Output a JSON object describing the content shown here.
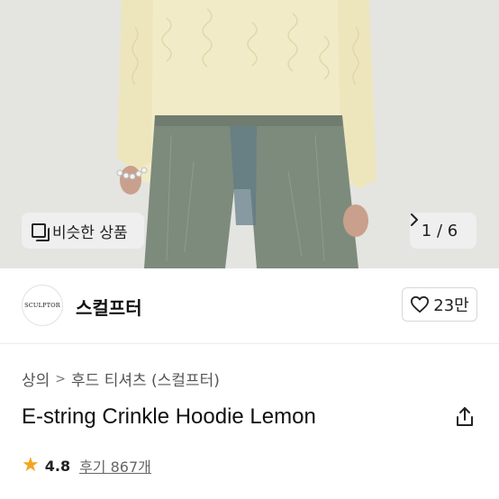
{
  "product_image": {
    "similar_button_label": "비슷한 상품",
    "pager": {
      "current": "1",
      "separator": "/",
      "total": "6",
      "text": "1 / 6"
    }
  },
  "brand": {
    "logo_text": "SCULPTOR",
    "name": "스컬프터",
    "like_count": "23만"
  },
  "breadcrumb": {
    "items": [
      "상의",
      "후드 티셔츠 (스컬프터)"
    ],
    "separator": ">"
  },
  "product": {
    "title": "E-string Crinkle Hoodie Lemon"
  },
  "rating": {
    "score": "4.8",
    "reviews_label": "후기 867개"
  },
  "colors": {
    "star": "#f3a51f",
    "sweater": "#f1ebc7",
    "jeans": "#7d8b7d"
  },
  "icons": {
    "similar": "similar-items-icon",
    "pager_next": "chevron-right-icon",
    "like": "heart-outline-icon",
    "share": "share-icon",
    "rating": "star-icon"
  }
}
